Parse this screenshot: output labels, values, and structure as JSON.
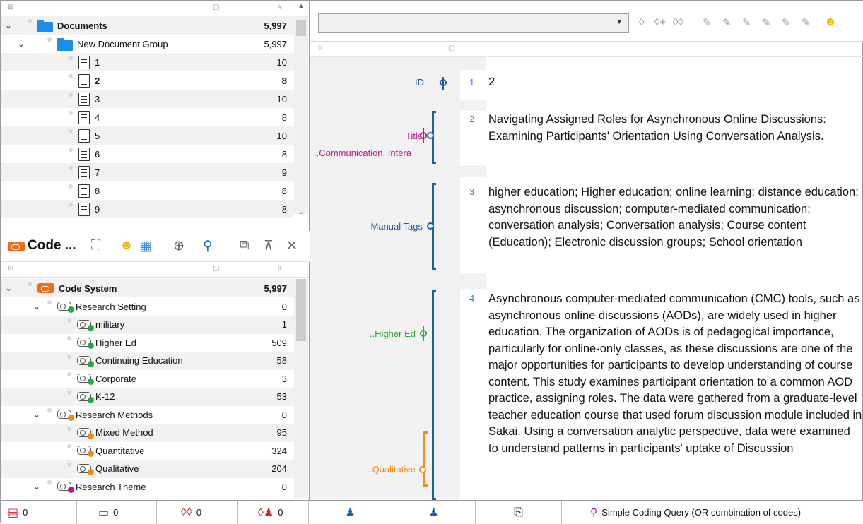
{
  "document_tree": {
    "root": {
      "label": "Documents",
      "count": "5,997"
    },
    "group": {
      "label": "New Document Group",
      "count": "5,997"
    },
    "items": [
      {
        "label": "1",
        "count": "10"
      },
      {
        "label": "2",
        "count": "8"
      },
      {
        "label": "3",
        "count": "10"
      },
      {
        "label": "4",
        "count": "8"
      },
      {
        "label": "5",
        "count": "10"
      },
      {
        "label": "6",
        "count": "8"
      },
      {
        "label": "7",
        "count": "9"
      },
      {
        "label": "8",
        "count": "8"
      },
      {
        "label": "9",
        "count": "8"
      }
    ]
  },
  "code_pane": {
    "title": "Code ...",
    "root": {
      "label": "Code System",
      "count": "5,997"
    },
    "items": [
      {
        "label": "Research Setting",
        "count": "0",
        "color": "#27a844"
      },
      {
        "label": "military",
        "count": "1",
        "color": "#27a844"
      },
      {
        "label": "Higher Ed",
        "count": "509",
        "color": "#27a844"
      },
      {
        "label": "Continuing Education",
        "count": "58",
        "color": "#27a844"
      },
      {
        "label": "Corporate",
        "count": "3",
        "color": "#27a844"
      },
      {
        "label": "K-12",
        "count": "53",
        "color": "#27a844"
      },
      {
        "label": "Research Methods",
        "count": "0",
        "color": "#f28a1a"
      },
      {
        "label": "Mixed Method",
        "count": "95",
        "color": "#f28a1a"
      },
      {
        "label": "Quantitative",
        "count": "324",
        "color": "#f28a1a"
      },
      {
        "label": "Qualitative",
        "count": "204",
        "color": "#f28a1a"
      },
      {
        "label": "Research Theme",
        "count": "0",
        "color": "#c0158c"
      }
    ]
  },
  "status_bar": {
    "docs": "0",
    "codes": "0",
    "memos": "0",
    "users": "0",
    "query": "Simple Coding Query (OR combination of codes)"
  },
  "browser": {
    "codes": [
      {
        "label": "ID",
        "color": "#1d5fae"
      },
      {
        "label": "Title",
        "color": "#c0158c"
      },
      {
        "label": "..Communication, Intera",
        "color": "#c0158c"
      },
      {
        "label": "Manual Tags",
        "color": "#1d5fae"
      },
      {
        "label": "..Higher Ed",
        "color": "#27a844"
      },
      {
        "label": "..Qualitative",
        "color": "#f28a1a"
      }
    ],
    "paragraphs": [
      {
        "n": "1",
        "text": "2"
      },
      {
        "n": "2",
        "text": "Navigating Assigned Roles for Asynchronous Online Discussions: Examining Participants' Orientation Using Conversation Analysis."
      },
      {
        "n": "3",
        "text": "higher education; Higher education; online learning; distance education; asynchronous discussion; computer-mediated communication; conversation analysis; Conversation analysis; Course content (Education); Electronic discussion groups; School orientation"
      },
      {
        "n": "4",
        "text": "Asynchronous computer-mediated communication (CMC) tools, such as asynchronous online discussions (AODs), are widely used in higher education. The organization of AODs is of pedagogical importance, particularly for online-only classes, as these discussions are one of the major opportunities for participants to develop understanding of course content. This study examines participant orientation to a common AOD practice, assigning roles. The data were gathered from a graduate-level teacher education course that used forum discussion module included in Sakai. Using a conversation analytic perspective, data were examined to understand patterns in participants' uptake of Discussion"
      }
    ]
  }
}
